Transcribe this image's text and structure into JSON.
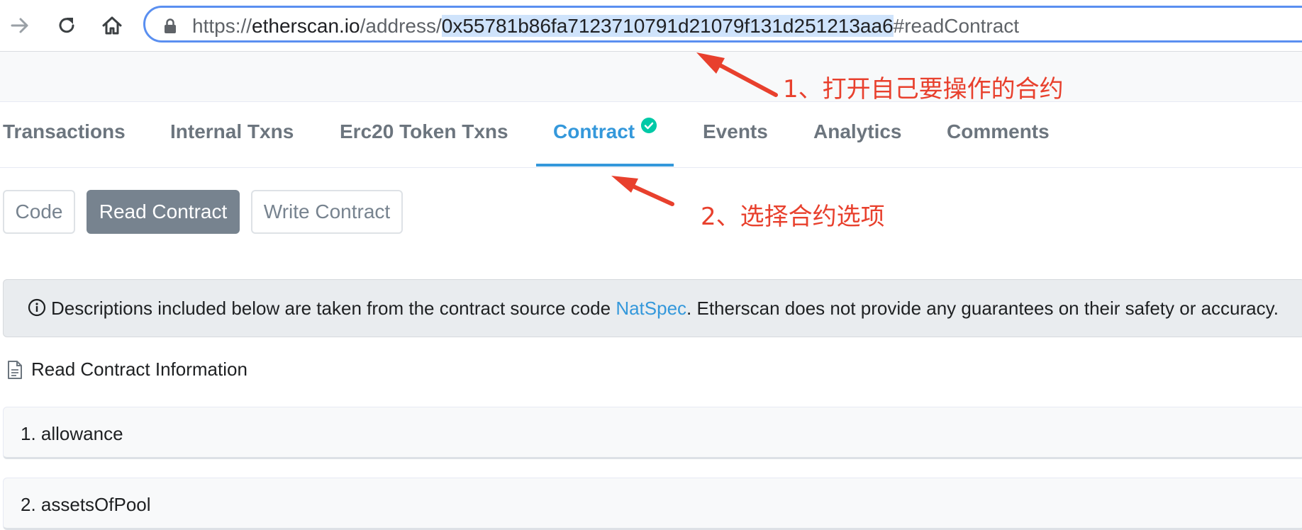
{
  "browser": {
    "url_prefix": "https://",
    "url_host": "etherscan.io",
    "url_path": "/address/",
    "url_selected": "0x55781b86fa7123710791d21079f131d251213aa6",
    "url_fragment": "#readContract"
  },
  "tabs": [
    {
      "label": "Transactions"
    },
    {
      "label": "Internal Txns"
    },
    {
      "label": "Erc20 Token Txns"
    },
    {
      "label": "Contract"
    },
    {
      "label": "Events"
    },
    {
      "label": "Analytics"
    },
    {
      "label": "Comments"
    }
  ],
  "sub_buttons": {
    "code": "Code",
    "read": "Read Contract",
    "write": "Write Contract"
  },
  "alert": {
    "before": "Descriptions included below are taken from the contract source code ",
    "link": "NatSpec",
    "after": ". Etherscan does not provide any guarantees on their safety or accuracy."
  },
  "section_title": "Read Contract Information",
  "functions": [
    {
      "label": "1. allowance"
    },
    {
      "label": "2. assetsOfPool"
    }
  ],
  "annotations": {
    "step1": "1、打开自己要操作的合约",
    "step2": "2、选择合约选项"
  },
  "colors": {
    "accent": "#3498db",
    "annotation": "#e8402d",
    "verified": "#00c9a7"
  }
}
